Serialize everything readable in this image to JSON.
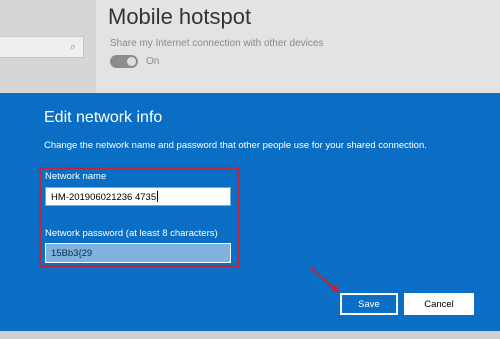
{
  "background": {
    "page_title": "Mobile hotspot",
    "share_description": "Share my Internet connection with other devices",
    "toggle_state": "On"
  },
  "dialog": {
    "title": "Edit network info",
    "description": "Change the network name and password that other people use for your shared connection.",
    "network_name_label": "Network name",
    "network_name_value": "HM-201906021236 4735",
    "network_password_label": "Network password (at least 8 characters)",
    "network_password_value": "15Bb3{29",
    "save_label": "Save",
    "cancel_label": "Cancel"
  },
  "colors": {
    "dialog_bg": "#0a6fc4",
    "highlight": "#c0233a"
  }
}
